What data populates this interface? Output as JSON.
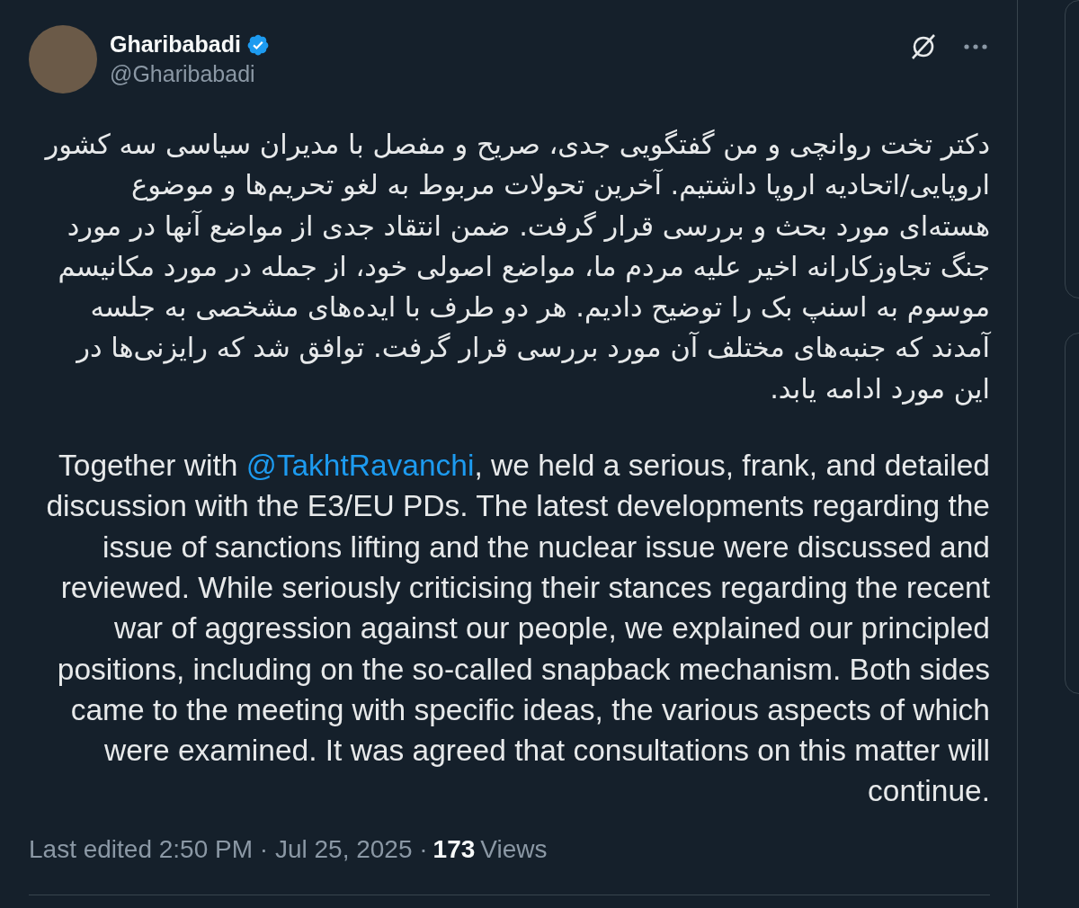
{
  "author": {
    "name": "Gharibabadi",
    "handle": "@Gharibabadi",
    "verified": true
  },
  "post": {
    "persian_text": "دکتر تخت روانچی و من گفتگویی جدی، صریح و مفصل با مدیران سیاسی سه کشور اروپایی/اتحادیه اروپا داشتیم. آخرین تحولات مربوط به لغو تحریم‌ها و موضوع هسته‌ای مورد بحث و بررسی قرار گرفت. ضمن انتقاد جدی از مواضع آنها در مورد جنگ تجاوزکارانه اخیر علیه مردم ما، مواضع اصولی خود، از جمله در مورد مکانیسم موسوم به اسنپ بک را توضیح دادیم. هر دو طرف با ایده‌های مشخصی به جلسه آمدند که جنبه‌های مختلف آن مورد بررسی قرار گرفت. توافق شد که رایزنی‌ها در این مورد ادامه یابد.",
    "english_text": {
      "text_before": "Together with ",
      "mention": "@TakhtRavanchi",
      "text_after": ", we held a serious, frank, and detailed discussion with the E3/EU PDs. The latest developments regarding the issue of sanctions lifting and the nuclear issue were discussed and reviewed. While seriously criticising their stances regarding the recent war of aggression against our people, we explained our principled positions, including on the so-called snapback mechanism. Both sides came to the meeting with specific ideas, the various aspects of which were examined. It was agreed that consultations on this matter will continue."
    }
  },
  "meta": {
    "edited": "Last edited 2:50 PM · Jul 25, 2025 ·",
    "views_count": "173",
    "views_label": "Views"
  }
}
